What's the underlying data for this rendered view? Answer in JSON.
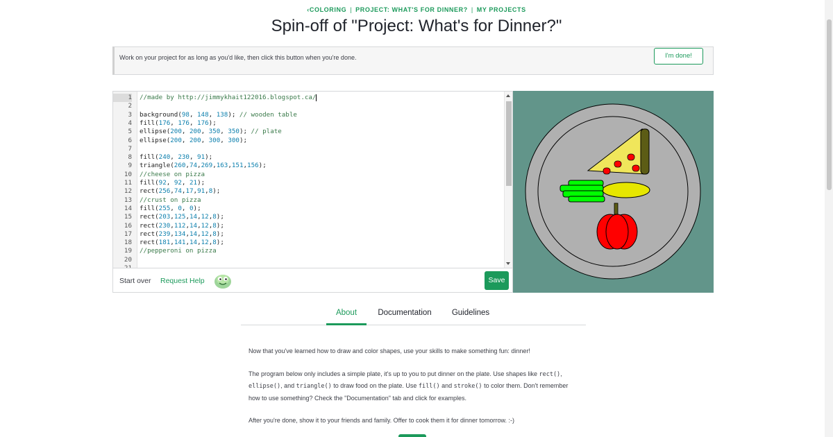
{
  "breadcrumb": {
    "back_arrow": "‹",
    "items": [
      "COLORING",
      "PROJECT: WHAT'S FOR DINNER?",
      "MY PROJECTS"
    ],
    "separator": "|"
  },
  "page": {
    "title": "Spin-off of \"Project: What's for Dinner?\""
  },
  "done_bar": {
    "message": "Work on your project for as long as you'd like, then click this button when you're done.",
    "button_label": "I'm done!"
  },
  "editor": {
    "active_line": 1,
    "lines": [
      "//made by http://jimmykhait122016.blogspot.ca/",
      "",
      "background(98, 148, 138); // wooden table",
      "fill(176, 176, 176);",
      "ellipse(200, 200, 350, 350); // plate",
      "ellipse(200, 200, 300, 300);",
      "",
      "fill(240, 230, 91);",
      "triangle(260,74,269,163,151,156);",
      "//cheese on pizza",
      "fill(92, 92, 21);",
      "rect(256,74,17,91,8);",
      "//crust on pizza",
      "fill(255, 0, 0);",
      "rect(203,125,14,12,8);",
      "rect(230,112,14,12,8);",
      "rect(239,134,14,12,8);",
      "rect(181,141,14,12,8);",
      "//pepperoni on pizza",
      "",
      ""
    ],
    "footer": {
      "start_over": "Start over",
      "request_help": "Request Help",
      "save": "Save"
    }
  },
  "colors": {
    "accent": "#1c9a5b",
    "canvas_bg": "#62958a",
    "plate": "#b0b0b0",
    "cheese": "#f0e65b",
    "crust": "#5c5c15",
    "pepperoni": "#ff0000",
    "green_food": "#00ff00",
    "yellow_food": "#e6e600"
  },
  "tabs": [
    {
      "label": "About",
      "active": true
    },
    {
      "label": "Documentation",
      "active": false
    },
    {
      "label": "Guidelines",
      "active": false
    }
  ],
  "about": {
    "p1": "Now that you've learned how to draw and color shapes, use your skills to make something fun: dinner!",
    "p2_a": "The program below only includes a simple plate, it's up to you to put dinner on the plate. Use shapes like ",
    "p2_code1": "rect()",
    "p2_b": ", ",
    "p2_code2": "ellipse()",
    "p2_c": ", and ",
    "p2_code3": "triangle()",
    "p2_d": " to draw food on the plate. Use ",
    "p2_code4": "fill()",
    "p2_e": " and ",
    "p2_code5": "stroke()",
    "p2_f": " to color them. Don't remember how to use something? Check the \"Documentation\" tab and click for examples.",
    "p3": "After you're done, show it to your friends and family. Offer to cook them it for dinner tomorrow. :-)"
  }
}
